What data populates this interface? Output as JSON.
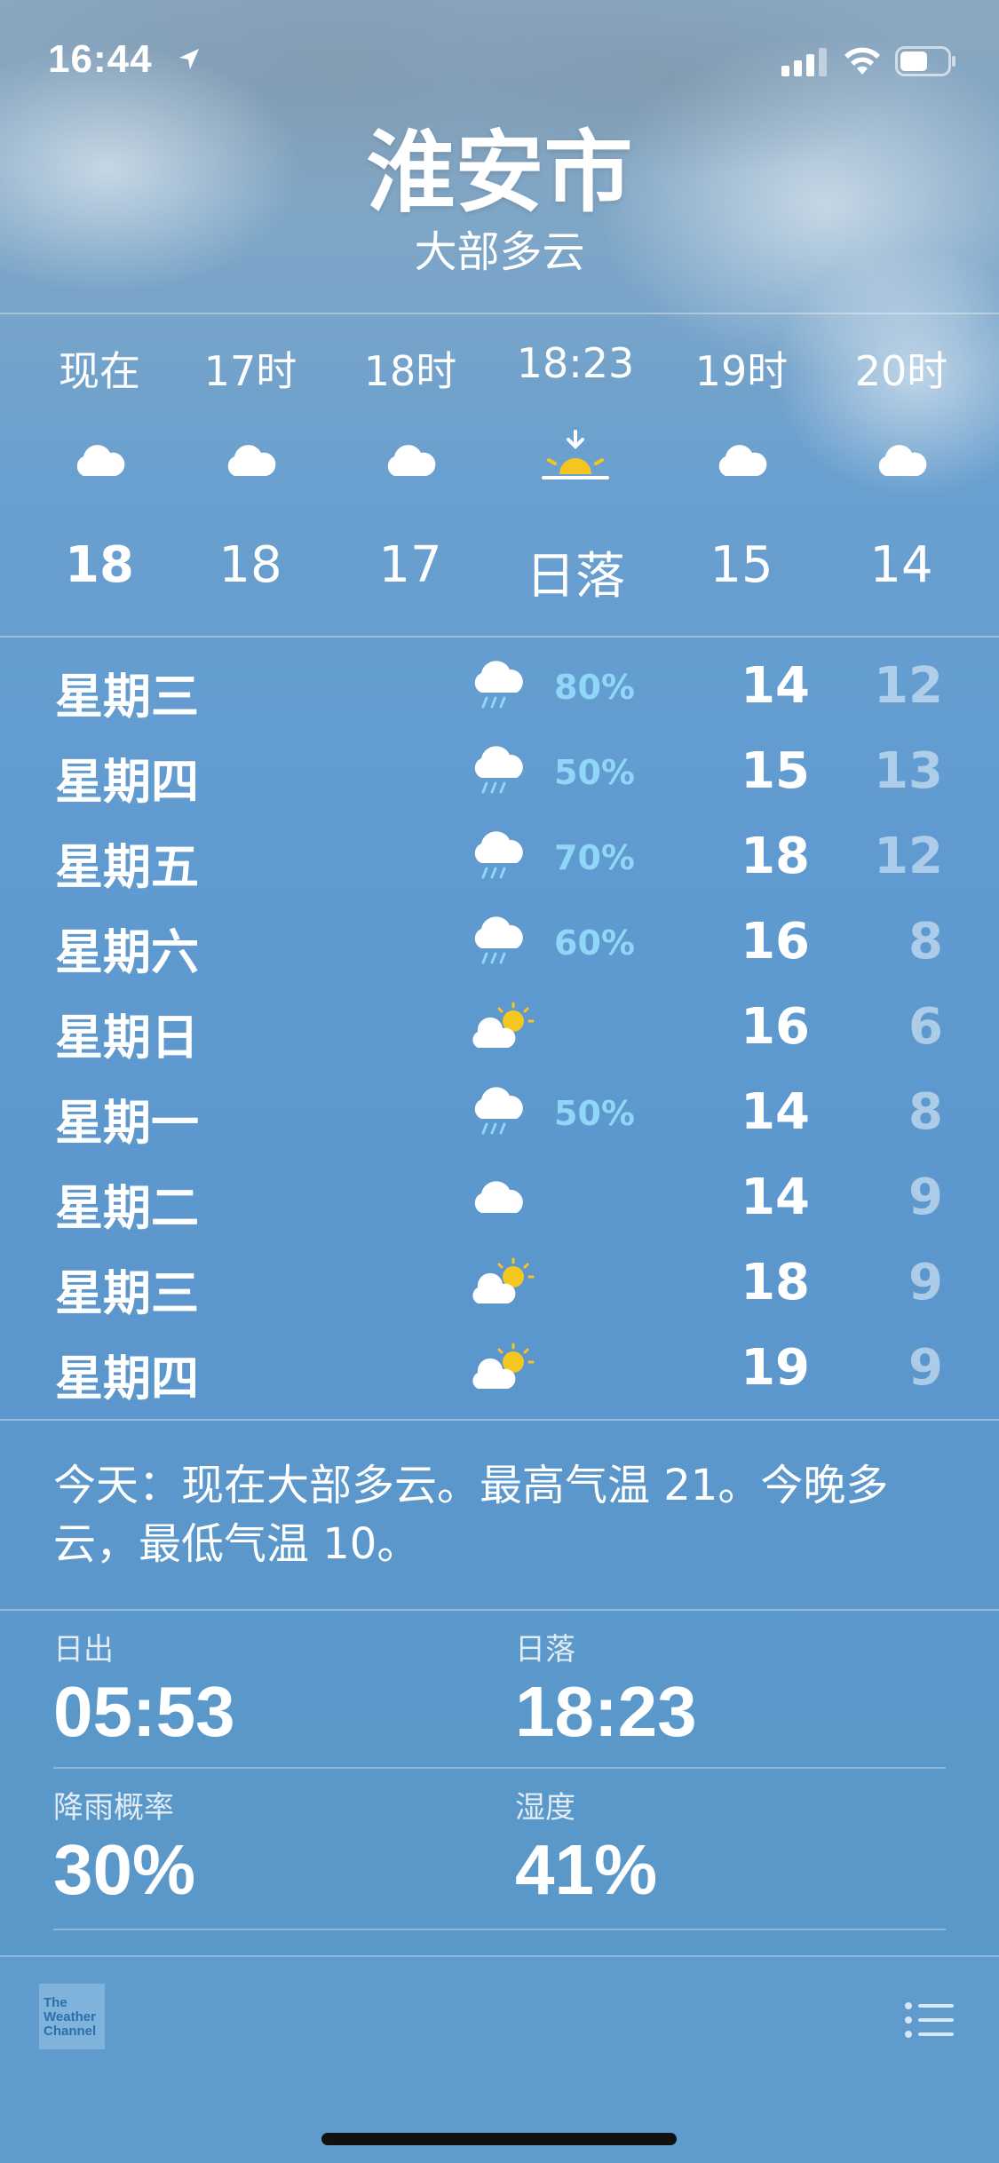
{
  "status_bar": {
    "time": "16:44",
    "icons": [
      "location-arrow-icon",
      "signal-icon",
      "wifi-icon",
      "battery-icon"
    ]
  },
  "header": {
    "city": "淮安市",
    "condition": "大部多云"
  },
  "hourly": [
    {
      "label": "现在",
      "icon": "cloud-icon",
      "temp": "18",
      "bold": true
    },
    {
      "label": "17时",
      "icon": "cloud-icon",
      "temp": "18",
      "bold": false
    },
    {
      "label": "18时",
      "icon": "cloud-icon",
      "temp": "17",
      "bold": false
    },
    {
      "label": "18:23",
      "icon": "sunset-icon",
      "temp": "日落",
      "bold": false
    },
    {
      "label": "19时",
      "icon": "cloud-icon",
      "temp": "15",
      "bold": false
    },
    {
      "label": "20时",
      "icon": "cloud-icon",
      "temp": "14",
      "bold": false
    }
  ],
  "daily": [
    {
      "day": "星期三",
      "icon": "rain-icon",
      "pop": "80%",
      "high": "14",
      "low": "12"
    },
    {
      "day": "星期四",
      "icon": "rain-icon",
      "pop": "50%",
      "high": "15",
      "low": "13"
    },
    {
      "day": "星期五",
      "icon": "rain-icon",
      "pop": "70%",
      "high": "18",
      "low": "12"
    },
    {
      "day": "星期六",
      "icon": "rain-icon",
      "pop": "60%",
      "high": "16",
      "low": "8"
    },
    {
      "day": "星期日",
      "icon": "partly-sunny-icon",
      "pop": "",
      "high": "16",
      "low": "6"
    },
    {
      "day": "星期一",
      "icon": "rain-icon",
      "pop": "50%",
      "high": "14",
      "low": "8"
    },
    {
      "day": "星期二",
      "icon": "cloud-icon",
      "pop": "",
      "high": "14",
      "low": "9"
    },
    {
      "day": "星期三",
      "icon": "partly-sunny-icon",
      "pop": "",
      "high": "18",
      "low": "9"
    },
    {
      "day": "星期四",
      "icon": "partly-sunny-icon",
      "pop": "",
      "high": "19",
      "low": "9"
    }
  ],
  "summary": "今天：现在大部多云。最高气温 21。今晚多云，最低气温 10。",
  "details": {
    "sunrise_label": "日出",
    "sunrise_value": "05:53",
    "sunset_label": "日落",
    "sunset_value": "18:23",
    "rain_label": "降雨概率",
    "rain_value": "30%",
    "humidity_label": "湿度",
    "humidity_value": "41%"
  },
  "footer": {
    "logo_text": [
      "The",
      "Weather",
      "Channel"
    ],
    "list_icon": "list-icon"
  },
  "colors": {
    "pop": "#8fd6f7",
    "sun": "#f5c61f",
    "background": "#5f9bcc"
  }
}
